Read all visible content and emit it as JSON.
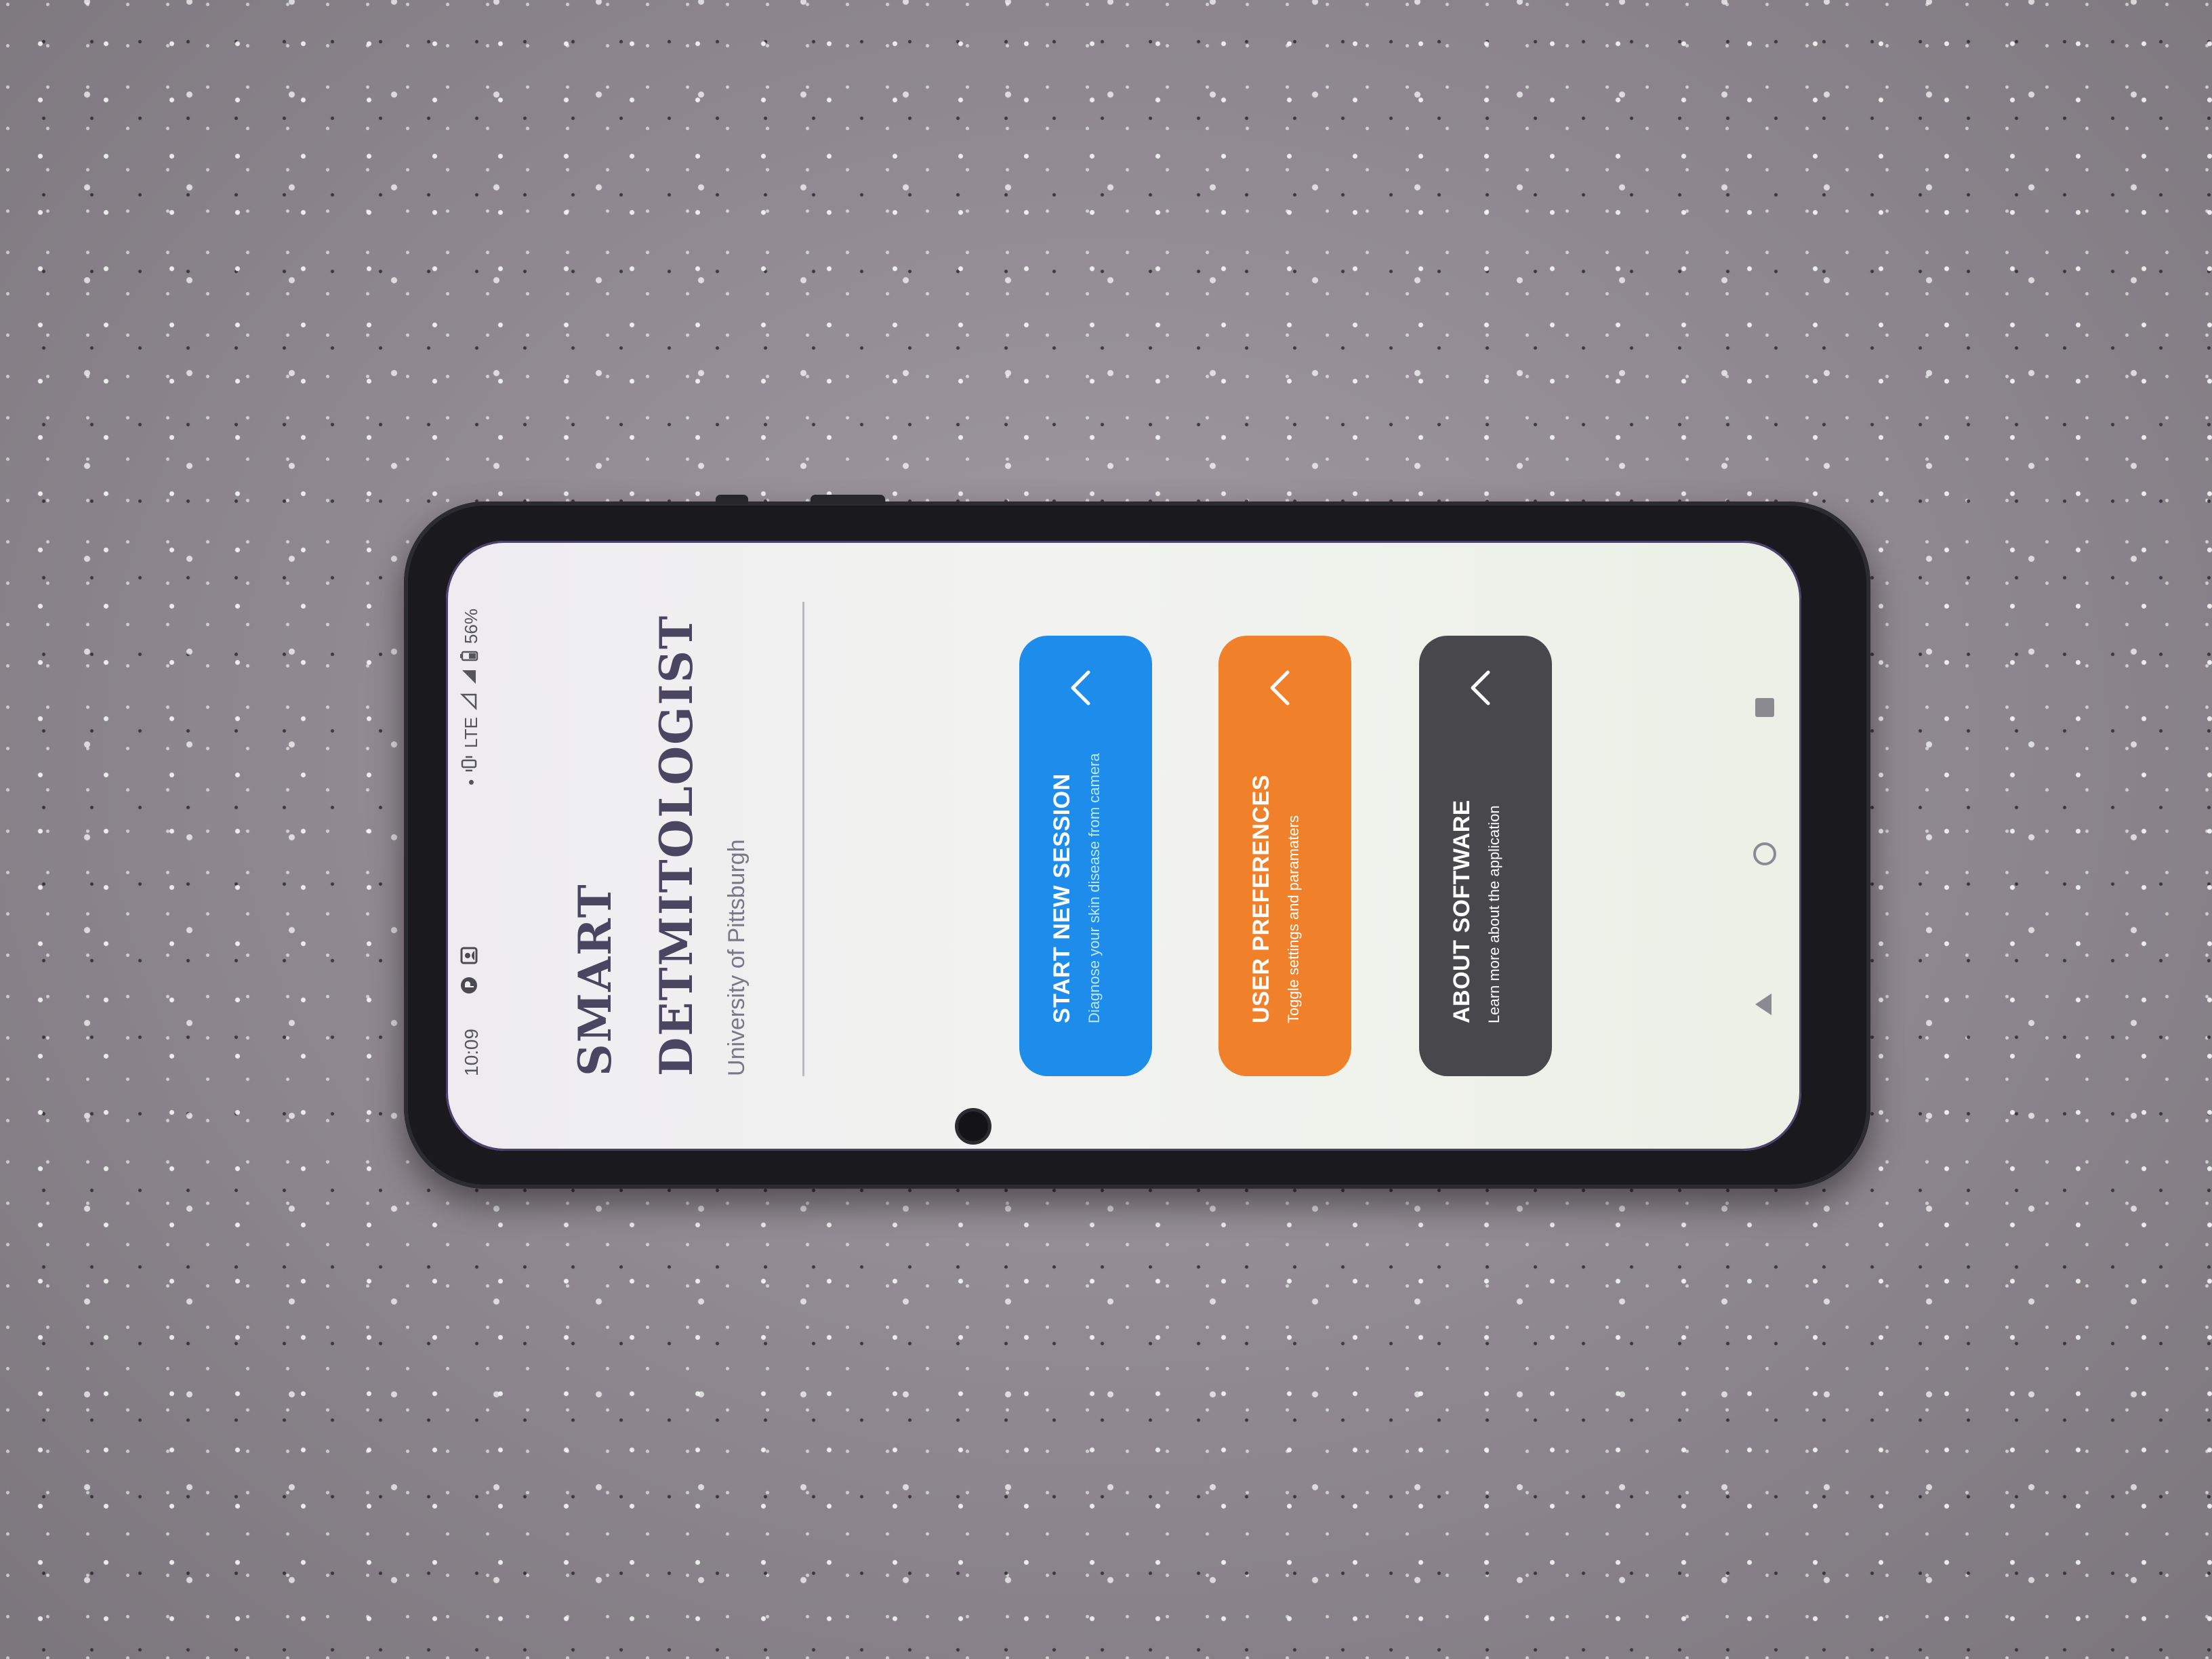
{
  "status_bar": {
    "time": "10:09",
    "network": "LTE",
    "battery": "56%",
    "icons": [
      "notification-app-icon",
      "photo-notification-icon",
      "vibrate-icon",
      "signal-icon",
      "signal-icon",
      "battery-icon"
    ]
  },
  "app": {
    "title_line1": "SMART",
    "title_line2": "DETMITOLOGIST",
    "subtitle": "University of Pittsburgh"
  },
  "menu": [
    {
      "title": "START NEW SESSION",
      "subtitle": "Diagnose your skin disease from camera",
      "color": "#1d8cea",
      "icon": "chevron-up-icon"
    },
    {
      "title": "USER PREFERENCES",
      "subtitle": "Toggle settings and paramaters",
      "color": "#f0802a",
      "icon": "chevron-up-icon"
    },
    {
      "title": "ABOUT SOFTWARE",
      "subtitle": "Learn more about the application",
      "color": "#48474b",
      "icon": "chevron-up-icon"
    }
  ],
  "nav_bar": {
    "icons": [
      "back-icon",
      "home-icon",
      "recents-icon"
    ]
  }
}
